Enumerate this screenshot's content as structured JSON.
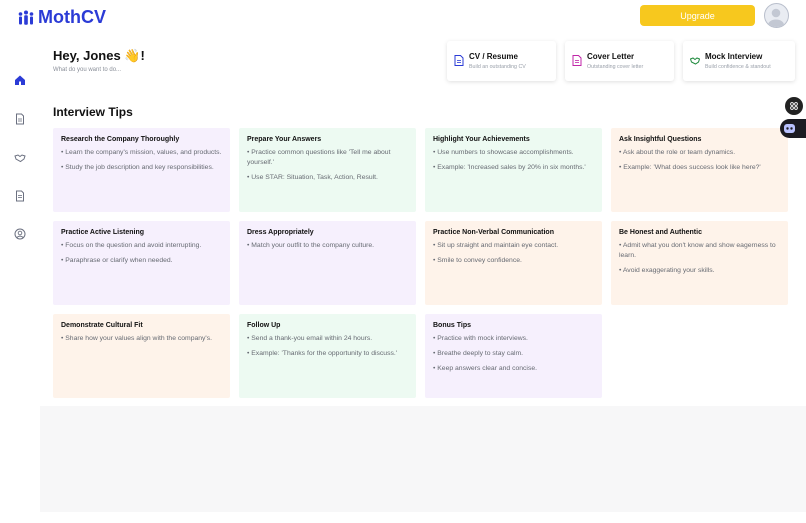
{
  "app": {
    "name": "MothCV"
  },
  "header": {
    "upgrade_label": "Upgrade"
  },
  "greeting": {
    "title": "Hey, Jones 👋!",
    "subtitle": "What do you want to do..."
  },
  "quick_actions": [
    {
      "title": "CV / Resume",
      "subtitle": "Build an outstanding CV",
      "icon": "document-icon"
    },
    {
      "title": "Cover Letter",
      "subtitle": "Outstanding cover letter",
      "icon": "letter-icon"
    },
    {
      "title": "Mock Interview",
      "subtitle": "Build confidence & standout",
      "icon": "handshake-icon"
    }
  ],
  "section_title": "Interview Tips",
  "tips": [
    {
      "title": "Research the Company Thoroughly",
      "items": [
        "• Learn the company's mission, values, and products.",
        "• Study the job description and key responsibilities."
      ]
    },
    {
      "title": "Prepare Your Answers",
      "items": [
        "• Practice common questions like 'Tell me about yourself.'",
        "• Use STAR: Situation, Task, Action, Result."
      ]
    },
    {
      "title": "Highlight Your Achievements",
      "items": [
        "• Use numbers to showcase accomplishments.",
        "• Example: 'Increased sales by 20% in six months.'"
      ]
    },
    {
      "title": "Ask Insightful Questions",
      "items": [
        "• Ask about the role or team dynamics.",
        "• Example: 'What does success look like here?'"
      ]
    },
    {
      "title": "Practice Active Listening",
      "items": [
        "• Focus on the question and avoid interrupting.",
        "• Paraphrase or clarify when needed."
      ]
    },
    {
      "title": "Dress Appropriately",
      "items": [
        "• Match your outfit to the company culture."
      ]
    },
    {
      "title": "Practice Non-Verbal Communication",
      "items": [
        "• Sit up straight and maintain eye contact.",
        "• Smile to convey confidence."
      ]
    },
    {
      "title": "Be Honest and Authentic",
      "items": [
        "• Admit what you don't know and show eagerness to learn.",
        "• Avoid exaggerating your skills."
      ]
    },
    {
      "title": "Demonstrate Cultural Fit",
      "items": [
        "• Share how your values align with the company's."
      ]
    },
    {
      "title": "Follow Up",
      "items": [
        "• Send a thank-you email within 24 hours.",
        "• Example: 'Thanks for the opportunity to discuss.'"
      ]
    },
    {
      "title": "Bonus Tips",
      "items": [
        "• Practice with mock interviews.",
        "• Breathe deeply to stay calm.",
        "• Keep answers clear and concise."
      ]
    }
  ],
  "colors": {
    "brand": "#2b3bd6",
    "upgrade": "#f7c81e",
    "card_purple": "#f6f0fd",
    "card_green": "#edfaf2",
    "card_orange": "#fef3ea"
  },
  "sidebar_icons": [
    "home-icon",
    "document-icon",
    "handshake-icon",
    "file-icon",
    "user-circle-icon"
  ]
}
